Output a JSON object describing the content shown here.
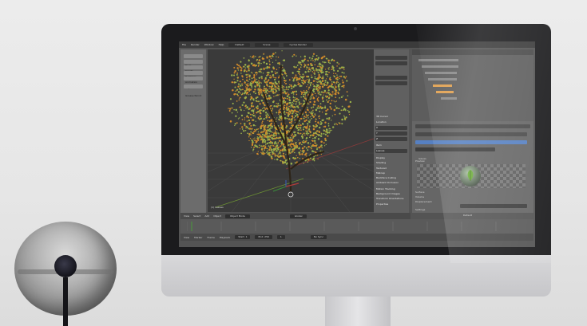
{
  "screen": {
    "topbar": {
      "items": [
        "File",
        "Render",
        "Window",
        "Help",
        "Default",
        "Scene",
        "Cycles Render"
      ]
    },
    "toolshelf": {
      "items": [
        "Tools",
        "Create",
        "Relations",
        "Animation",
        "Physics",
        "Grease Pencil"
      ]
    },
    "viewport": {
      "object_label": "(1) Leaves"
    },
    "npanel": {
      "rows": [
        "3D Cursor",
        "Location",
        "X",
        "Y",
        "Z",
        "Item",
        "Leaves",
        "Display",
        "Shading",
        "Textured",
        "Matcap",
        "Backface Culling",
        "Ambient Occlusion",
        "Motion Tracking",
        "Background Images",
        "Transform Orientations",
        "Properties"
      ]
    },
    "properties": {
      "material_name": "leaves",
      "sections": [
        "Preview",
        "Surface",
        "Volume",
        "Displacement",
        "Settings"
      ],
      "displacement_value": "Default"
    },
    "header_3d": {
      "items": [
        "View",
        "Select",
        "Add",
        "Object",
        "Object Mode",
        "Global"
      ]
    },
    "timeline_header": {
      "items": [
        "View",
        "Marker",
        "Frame",
        "Playback"
      ],
      "start_label": "Start:",
      "start_value": "1",
      "end_label": "End:",
      "end_value": "250",
      "current_value": "1",
      "sync": "No Sync"
    }
  },
  "colors": {
    "accent_blue": "#5680c2",
    "leaf_green": "#9ab04a",
    "leaf_orange": "#d08a2a"
  }
}
